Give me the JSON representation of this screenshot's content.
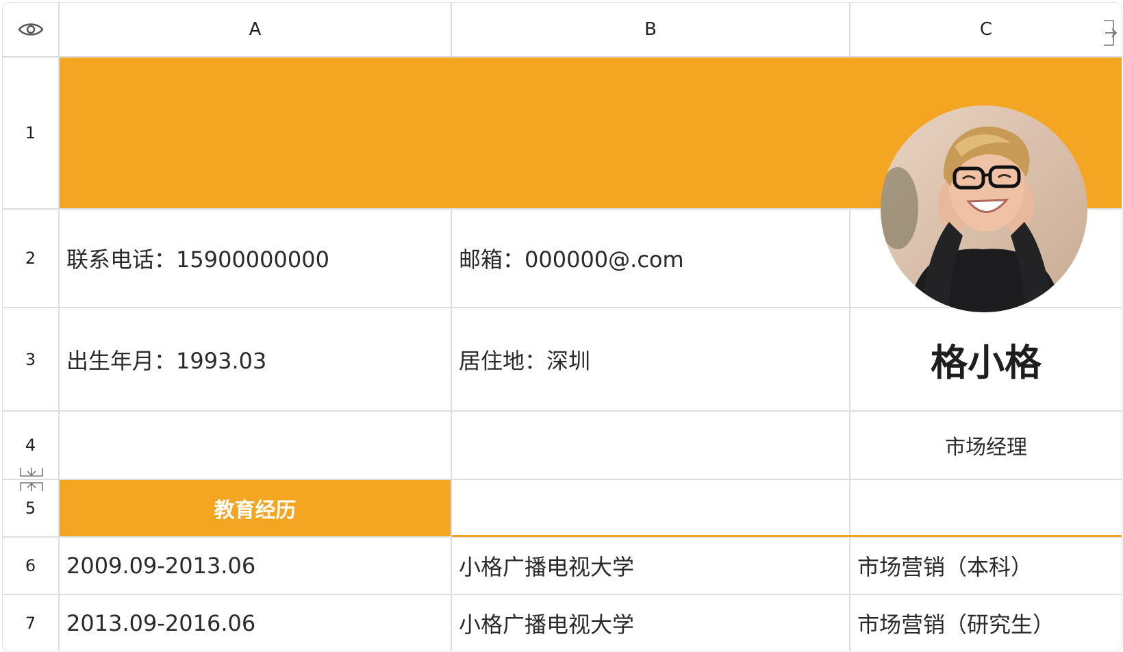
{
  "columns": [
    "A",
    "B",
    "C"
  ],
  "rows": [
    "1",
    "2",
    "3",
    "4",
    "5",
    "6",
    "7"
  ],
  "contact": {
    "phone": "联系电话：15900000000",
    "email": "邮箱：000000@.com",
    "birth": "出生年月：1993.03",
    "residence": "居住地：深圳"
  },
  "profile": {
    "name": "格小格",
    "title": "市场经理"
  },
  "education": {
    "header": "教育经历",
    "entries": [
      {
        "period": "2009.09-2013.06",
        "school": "小格广播电视大学",
        "major": "市场营销（本科）"
      },
      {
        "period": "2013.09-2016.06",
        "school": "小格广播电视大学",
        "major": "市场营销（研究生）"
      }
    ]
  },
  "icons": {
    "view": "eye-icon",
    "expand": "expand-right-icon",
    "row_resize": "row-resize-icon",
    "photo": "profile-photo"
  },
  "colors": {
    "accent": "#f4a623",
    "grid": "#dedede"
  }
}
